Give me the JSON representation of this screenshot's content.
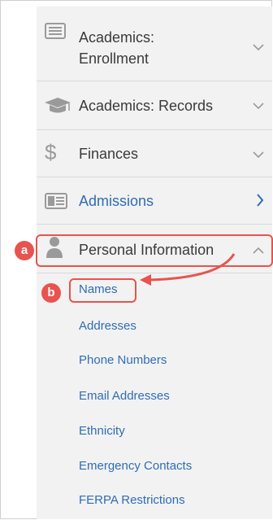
{
  "menu": {
    "items": [
      {
        "label_line1": "Academics:",
        "label_line2": "Enrollment",
        "icon": "id-card-icon",
        "chevron": "chevron-down-icon"
      },
      {
        "label": "Academics: Records",
        "icon": "graduation-cap-icon",
        "chevron": "chevron-down-icon"
      },
      {
        "label": "Finances",
        "icon": "dollar-icon",
        "chevron": "chevron-down-icon"
      },
      {
        "label": "Admissions",
        "icon": "id-card-icon",
        "chevron": "chevron-right-icon"
      },
      {
        "label": "Personal Information",
        "icon": "person-icon",
        "chevron": "chevron-up-icon"
      }
    ],
    "sub_items": [
      "Names",
      "Addresses",
      "Phone Numbers",
      "Email Addresses",
      "Ethnicity",
      "Emergency Contacts",
      "FERPA Restrictions"
    ]
  },
  "callouts": {
    "a": "a",
    "b": "b"
  },
  "colors": {
    "menu_bg": "#f2f2f2",
    "link": "#2f6db3",
    "callout": "#e8534f"
  }
}
